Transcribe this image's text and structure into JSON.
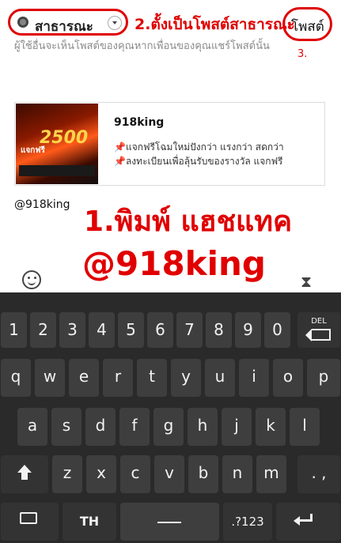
{
  "compose": {
    "privacy_label": "สาธารณะ",
    "post_label": "โพสต์",
    "notice": "ผู้ใช้อื่นจะเห็นโพสต์ของคุณหากเพื่อนของคุณแชร์โพสต์นั้น",
    "mention": "@918king"
  },
  "annotations": {
    "step2": "2.ตั้งเป็นโพสต์สาธารณะ",
    "step3": "3.",
    "step1": "1.พิมพ์ แฮชแทค",
    "step1_tag": "@918king",
    "color": "#e00000"
  },
  "link_card": {
    "title": "918king",
    "line1_icon": "📌",
    "line1": "แจกฟรีโฉมใหม่ปังกว่า แรงกว่า สดกว่า",
    "line2_icon": "📌",
    "line2": "ลงทะเบียนเพื่อลุ้นรับของรางวัล แจกฟรี",
    "thumb_number": "2500",
    "thumb_text": "แจกฟรี"
  },
  "keyboard": {
    "row1": [
      "1",
      "2",
      "3",
      "4",
      "5",
      "6",
      "7",
      "8",
      "9",
      "0"
    ],
    "del": "DEL",
    "row2": [
      "q",
      "w",
      "e",
      "r",
      "t",
      "y",
      "u",
      "i",
      "o",
      "p"
    ],
    "row3": [
      "a",
      "s",
      "d",
      "f",
      "g",
      "h",
      "j",
      "k",
      "l"
    ],
    "row4": [
      "z",
      "x",
      "c",
      "v",
      "b",
      "n",
      "m",
      ". ,"
    ],
    "lang": "TH",
    "sym": ".?123"
  }
}
